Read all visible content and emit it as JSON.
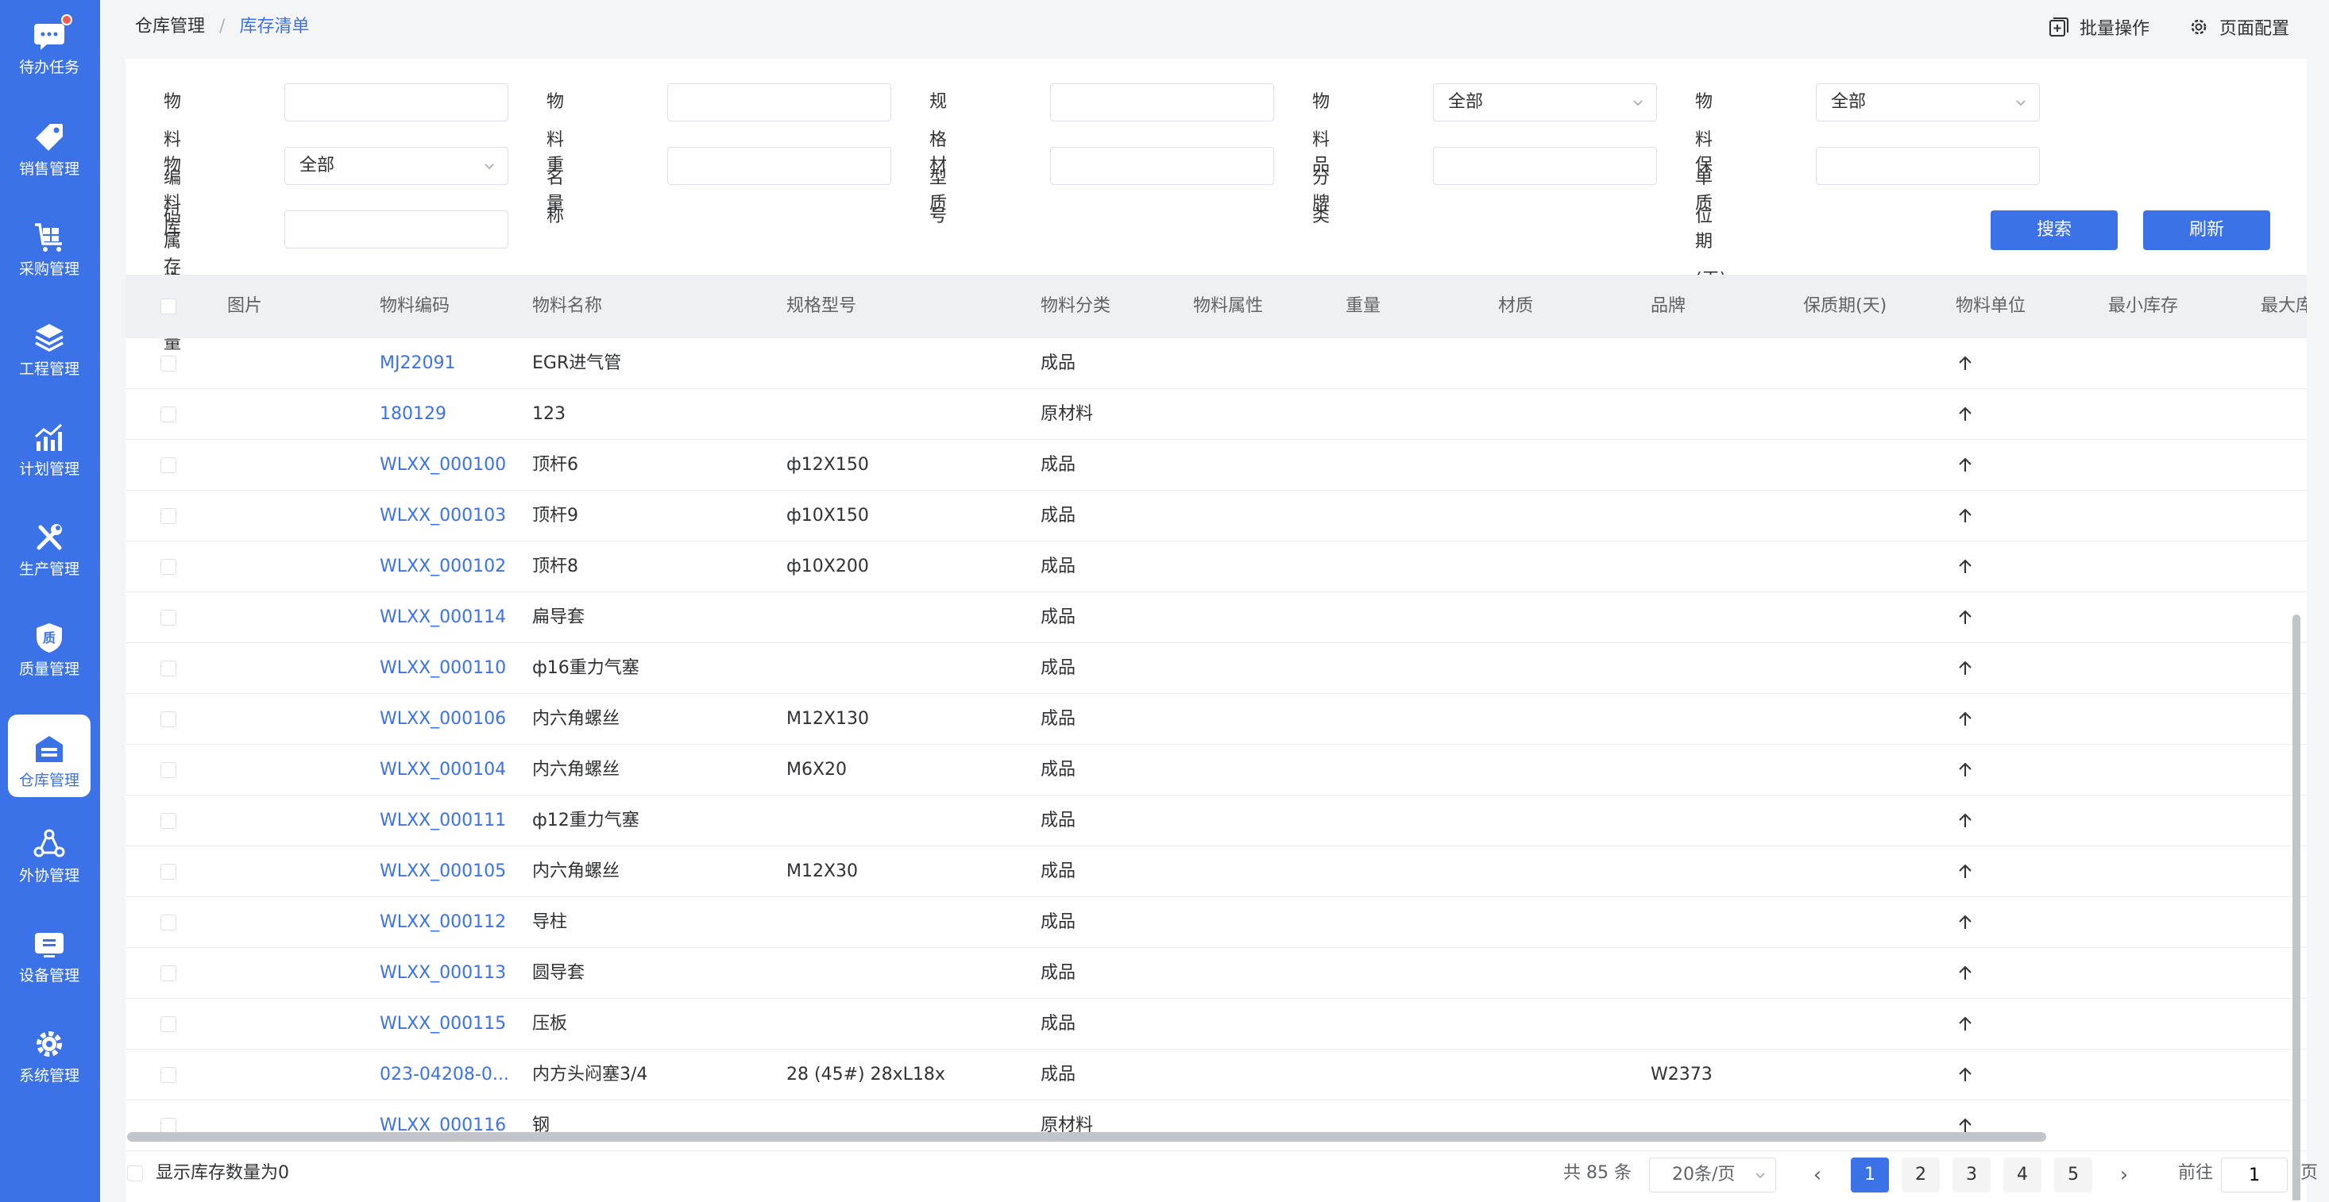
{
  "sidebar": {
    "items": [
      {
        "label": "待办任务",
        "icon": "chat-icon"
      },
      {
        "label": "销售管理",
        "icon": "tag-icon"
      },
      {
        "label": "采购管理",
        "icon": "cart-icon"
      },
      {
        "label": "工程管理",
        "icon": "layers-icon"
      },
      {
        "label": "计划管理",
        "icon": "chart-icon"
      },
      {
        "label": "生产管理",
        "icon": "tools-icon"
      },
      {
        "label": "质量管理",
        "icon": "shield-icon"
      },
      {
        "label": "仓库管理",
        "icon": "warehouse-icon"
      },
      {
        "label": "外协管理",
        "icon": "share-icon"
      },
      {
        "label": "设备管理",
        "icon": "device-icon"
      },
      {
        "label": "系统管理",
        "icon": "settings-icon"
      }
    ],
    "shield_glyph": "质"
  },
  "breadcrumb": {
    "parent": "仓库管理",
    "separator": "/",
    "current": "库存清单"
  },
  "top_actions": {
    "batch": "批量操作",
    "page_config": "页面配置"
  },
  "filters": {
    "code_label": "物料编码",
    "name_label": "物料名称",
    "spec_label": "规格型号",
    "category_label": "物料分类",
    "category_value": "全部",
    "unit_label": "物料单位",
    "unit_value": "全部",
    "attr_label": "物料属性",
    "attr_value": "全部",
    "weight_label": "重量",
    "material_label": "材质",
    "brand_label": "品牌",
    "shelf_label": "保质期(天)",
    "stock_label": "库存数量",
    "search_button": "搜索",
    "refresh_button": "刷新"
  },
  "table": {
    "columns": [
      "图片",
      "物料编码",
      "物料名称",
      "规格型号",
      "物料分类",
      "物料属性",
      "重量",
      "材质",
      "品牌",
      "保质期(天)",
      "物料单位",
      "最小库存",
      "最大库"
    ],
    "rows": [
      {
        "code": "MJ22091",
        "name": "EGR进气管",
        "spec": "",
        "category": "成品",
        "brand": ""
      },
      {
        "code": "180129",
        "name": "123",
        "spec": "",
        "category": "原材料",
        "brand": ""
      },
      {
        "code": "WLXX_000100",
        "name": "顶杆6",
        "spec": "ф12X150",
        "category": "成品",
        "brand": ""
      },
      {
        "code": "WLXX_000103",
        "name": "顶杆9",
        "spec": "ф10X150",
        "category": "成品",
        "brand": ""
      },
      {
        "code": "WLXX_000102",
        "name": "顶杆8",
        "spec": "ф10X200",
        "category": "成品",
        "brand": ""
      },
      {
        "code": "WLXX_000114",
        "name": "扁导套",
        "spec": "",
        "category": "成品",
        "brand": ""
      },
      {
        "code": "WLXX_000110",
        "name": "ф16重力气塞",
        "spec": "",
        "category": "成品",
        "brand": ""
      },
      {
        "code": "WLXX_000106",
        "name": "内六角螺丝",
        "spec": "M12X130",
        "category": "成品",
        "brand": ""
      },
      {
        "code": "WLXX_000104",
        "name": "内六角螺丝",
        "spec": "M6X20",
        "category": "成品",
        "brand": ""
      },
      {
        "code": "WLXX_000111",
        "name": "ф12重力气塞",
        "spec": "",
        "category": "成品",
        "brand": ""
      },
      {
        "code": "WLXX_000105",
        "name": "内六角螺丝",
        "spec": "M12X30",
        "category": "成品",
        "brand": ""
      },
      {
        "code": "WLXX_000112",
        "name": "导柱",
        "spec": "",
        "category": "成品",
        "brand": ""
      },
      {
        "code": "WLXX_000113",
        "name": "圆导套",
        "spec": "",
        "category": "成品",
        "brand": ""
      },
      {
        "code": "WLXX_000115",
        "name": "压板",
        "spec": "",
        "category": "成品",
        "brand": ""
      },
      {
        "code": "023-04208-0...",
        "name": "内方头闷塞3/4",
        "spec": "28 (45#) 28xL18x",
        "category": "成品",
        "brand": "W2373"
      },
      {
        "code": "WLXX_000116",
        "name": "钢",
        "spec": "",
        "category": "原材料",
        "brand": ""
      }
    ]
  },
  "footer": {
    "show_zero_label": "显示库存数量为0",
    "total": "共 85 条",
    "page_size": "20条/页",
    "pages": [
      "1",
      "2",
      "3",
      "4",
      "5"
    ],
    "active_page": "1",
    "prev": "‹",
    "next": "›",
    "goto_label": "前往",
    "goto_value": "1",
    "goto_suffix": "页"
  },
  "colors": {
    "primary": "#3b72e8",
    "badge": "#f25d4e",
    "header_bg": "#eef0f4"
  }
}
